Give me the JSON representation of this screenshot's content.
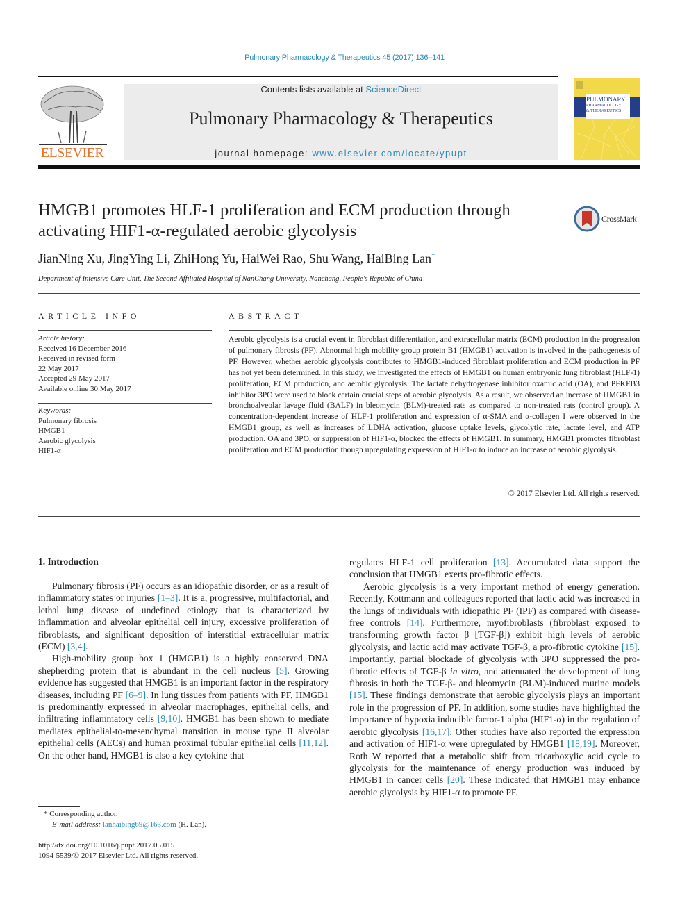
{
  "header": {
    "citation": "Pulmonary Pharmacology & Therapeutics 45 (2017) 136–141",
    "contents_prefix": "Contents lists available at ",
    "contents_link": "ScienceDirect",
    "journal_title": "Pulmonary Pharmacology & Therapeutics",
    "homepage_prefix": "journal homepage: ",
    "homepage_link": "www.elsevier.com/locate/ypupt",
    "publisher_logo_text": "ELSEVIER",
    "cover_title_lines": [
      "PULMONARY",
      "PHARMACOLOGY",
      "& THERAPEUTICS"
    ],
    "crossmark_label": "CrossMark"
  },
  "article": {
    "title": "HMGB1 promotes HLF-1 proliferation and ECM production through activating HIF1-α-regulated aerobic glycolysis",
    "authors": "JianNing Xu, JingYing Li, ZhiHong Yu, HaiWei Rao, Shu Wang, HaiBing Lan",
    "corresponding_mark": "*",
    "affiliation": "Department of Intensive Care Unit, The Second Affiliated Hospital of NanChang University, Nanchang, People's Republic of China"
  },
  "article_info": {
    "heading": "ARTICLE INFO",
    "history_label": "Article history:",
    "history": [
      "Received 16 December 2016",
      "Received in revised form",
      "22 May 2017",
      "Accepted 29 May 2017",
      "Available online 30 May 2017"
    ],
    "keywords_label": "Keywords:",
    "keywords": [
      "Pulmonary fibrosis",
      "HMGB1",
      "Aerobic glycolysis",
      "HIF1-α"
    ]
  },
  "abstract": {
    "heading": "ABSTRACT",
    "text": "Aerobic glycolysis is a crucial event in fibroblast differentiation, and extracellular matrix (ECM) production in the progression of pulmonary fibrosis (PF). Abnormal high mobility group protein B1 (HMGB1) activation is involved in the pathogenesis of PF. However, whether aerobic glycolysis contributes to HMGB1-induced fibroblast proliferation and ECM production in PF has not yet been determined. In this study, we investigated the effects of HMGB1 on human embryonic lung fibroblast (HLF-1) proliferation, ECM production, and aerobic glycolysis. The lactate dehydrogenase inhibitor oxamic acid (OA), and PFKFB3 inhibitor 3PO were used to block certain crucial steps of aerobic glycolysis. As a result, we observed an increase of HMGB1 in bronchoalveolar lavage fluid (BALF) in bleomycin (BLM)-treated rats as compared to non-treated rats (control group). A concentration-dependent increase of HLF-1 proliferation and expression of α-SMA and α-collagen I were observed in the HMGB1 group, as well as increases of LDHA activation, glucose uptake levels, glycolytic rate, lactate level, and ATP production. OA and 3PO, or suppression of HIF1-α, blocked the effects of HMGB1. In summary, HMGB1 promotes fibroblast proliferation and ECM production though upregulating expression of HIF1-α to induce an increase of aerobic glycolysis.",
    "copyright": "© 2017 Elsevier Ltd. All rights reserved."
  },
  "introduction": {
    "heading": "1.  Introduction",
    "left_column": [
      {
        "segments": [
          {
            "t": "Pulmonary fibrosis (PF) occurs as an idiopathic disorder, or as a result of inflammatory states or injuries "
          },
          {
            "t": "[1–3]",
            "ref": true
          },
          {
            "t": ". It is a, progressive, multifactorial, and lethal lung disease of undefined etiology that is characterized by inflammation and alveolar epithelial cell injury, excessive proliferation of fibroblasts, and significant deposition of interstitial extracellular matrix (ECM) "
          },
          {
            "t": "[3,4]",
            "ref": true
          },
          {
            "t": "."
          }
        ]
      },
      {
        "segments": [
          {
            "t": "High-mobility group box 1 (HMGB1) is a highly conserved DNA shepherding protein that is abundant in the cell nucleus "
          },
          {
            "t": "[5]",
            "ref": true
          },
          {
            "t": ". Growing evidence has suggested that HMGB1 is an important factor in the respiratory diseases, including PF "
          },
          {
            "t": "[6–9]",
            "ref": true
          },
          {
            "t": ". In lung tissues from patients with PF, HMGB1 is predominantly expressed in alveolar macrophages, epithelial cells, and infiltrating inflammatory cells "
          },
          {
            "t": "[9,10]",
            "ref": true
          },
          {
            "t": ". HMGB1 has been shown to mediate mediates epithelial-to-mesenchymal transition in mouse type II alveolar epithelial cells (AECs) and human proximal tubular epithelial cells "
          },
          {
            "t": "[11,12]",
            "ref": true
          },
          {
            "t": ". On the other hand, HMGB1 is also a key cytokine that"
          }
        ]
      }
    ],
    "right_column": [
      {
        "noindent": true,
        "segments": [
          {
            "t": "regulates HLF-1 cell proliferation "
          },
          {
            "t": "[13]",
            "ref": true
          },
          {
            "t": ". Accumulated data support the conclusion that HMGB1 exerts pro-fibrotic effects."
          }
        ]
      },
      {
        "segments": [
          {
            "t": "Aerobic glycolysis is a very important method of energy generation. Recently, Kottmann and colleagues reported that lactic acid was increased in the lungs of individuals with idiopathic PF (IPF) as compared with disease-free controls "
          },
          {
            "t": "[14]",
            "ref": true
          },
          {
            "t": ". Furthermore, myofibroblasts (fibroblast exposed to transforming growth factor β [TGF-β]) exhibit high levels of aerobic glycolysis, and lactic acid may activate TGF-β, a pro-fibrotic cytokine "
          },
          {
            "t": "[15]",
            "ref": true
          },
          {
            "t": ". Importantly, partial blockade of glycolysis with 3PO suppressed the pro-fibrotic effects of TGF-β "
          },
          {
            "t": "in vitro",
            "ital": true
          },
          {
            "t": ", and attenuated the development of lung fibrosis in both the TGF-β- and bleomycin (BLM)-induced murine models "
          },
          {
            "t": "[15]",
            "ref": true
          },
          {
            "t": ". These findings demonstrate that aerobic glycolysis plays an important role in the progression of PF. In addition, some studies have highlighted the importance of hypoxia inducible factor-1 alpha (HIF1-α) in the regulation of aerobic glycolysis "
          },
          {
            "t": "[16,17]",
            "ref": true
          },
          {
            "t": ". Other studies have also reported the expression and activation of HIF1-α were upregulated by HMGB1 "
          },
          {
            "t": "[18,19]",
            "ref": true
          },
          {
            "t": ". Moreover, Roth W reported that a metabolic shift from tricarboxylic acid cycle to glycolysis for the maintenance of energy production was induced by HMGB1 in cancer cells "
          },
          {
            "t": "[20]",
            "ref": true
          },
          {
            "t": ". These indicated that HMGB1 may enhance aerobic glycolysis by HIF1-α to promote PF."
          }
        ]
      }
    ]
  },
  "footnotes": {
    "corresponding": "* Corresponding author.",
    "email_label": "E-mail address: ",
    "email": "lanhaibing69@163.com",
    "email_suffix": " (H. Lan).",
    "doi": "http://dx.doi.org/10.1016/j.pupt.2017.05.015",
    "issn_line": "1094-5539/© 2017 Elsevier Ltd. All rights reserved."
  },
  "colors": {
    "link": "#2a8ab8",
    "elsevier_orange": "#e8732a",
    "cover_yellow": "#f2d94a",
    "cover_blue": "#243e8c",
    "header_box": "#ececec"
  }
}
